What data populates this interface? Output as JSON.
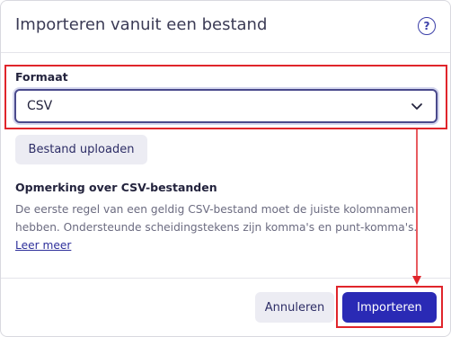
{
  "dialog": {
    "title": "Importeren vanuit een bestand",
    "help_icon": "question-circle-icon"
  },
  "format": {
    "label": "Formaat",
    "selected": "CSV"
  },
  "upload": {
    "label": "Bestand uploaden"
  },
  "note": {
    "title": "Opmerking over CSV-bestanden",
    "text": "De eerste regel van een geldig CSV-bestand moet de juiste kolomnamen hebben. Ondersteunde scheidingstekens zijn komma's en punt-komma's.",
    "link": "Leer meer"
  },
  "footer": {
    "cancel_label": "Annuleren",
    "import_label": "Importeren"
  },
  "colors": {
    "primary": "#2a2ab5",
    "highlight": "#e0252b",
    "text": "#23233d",
    "muted": "#6b6b80"
  }
}
